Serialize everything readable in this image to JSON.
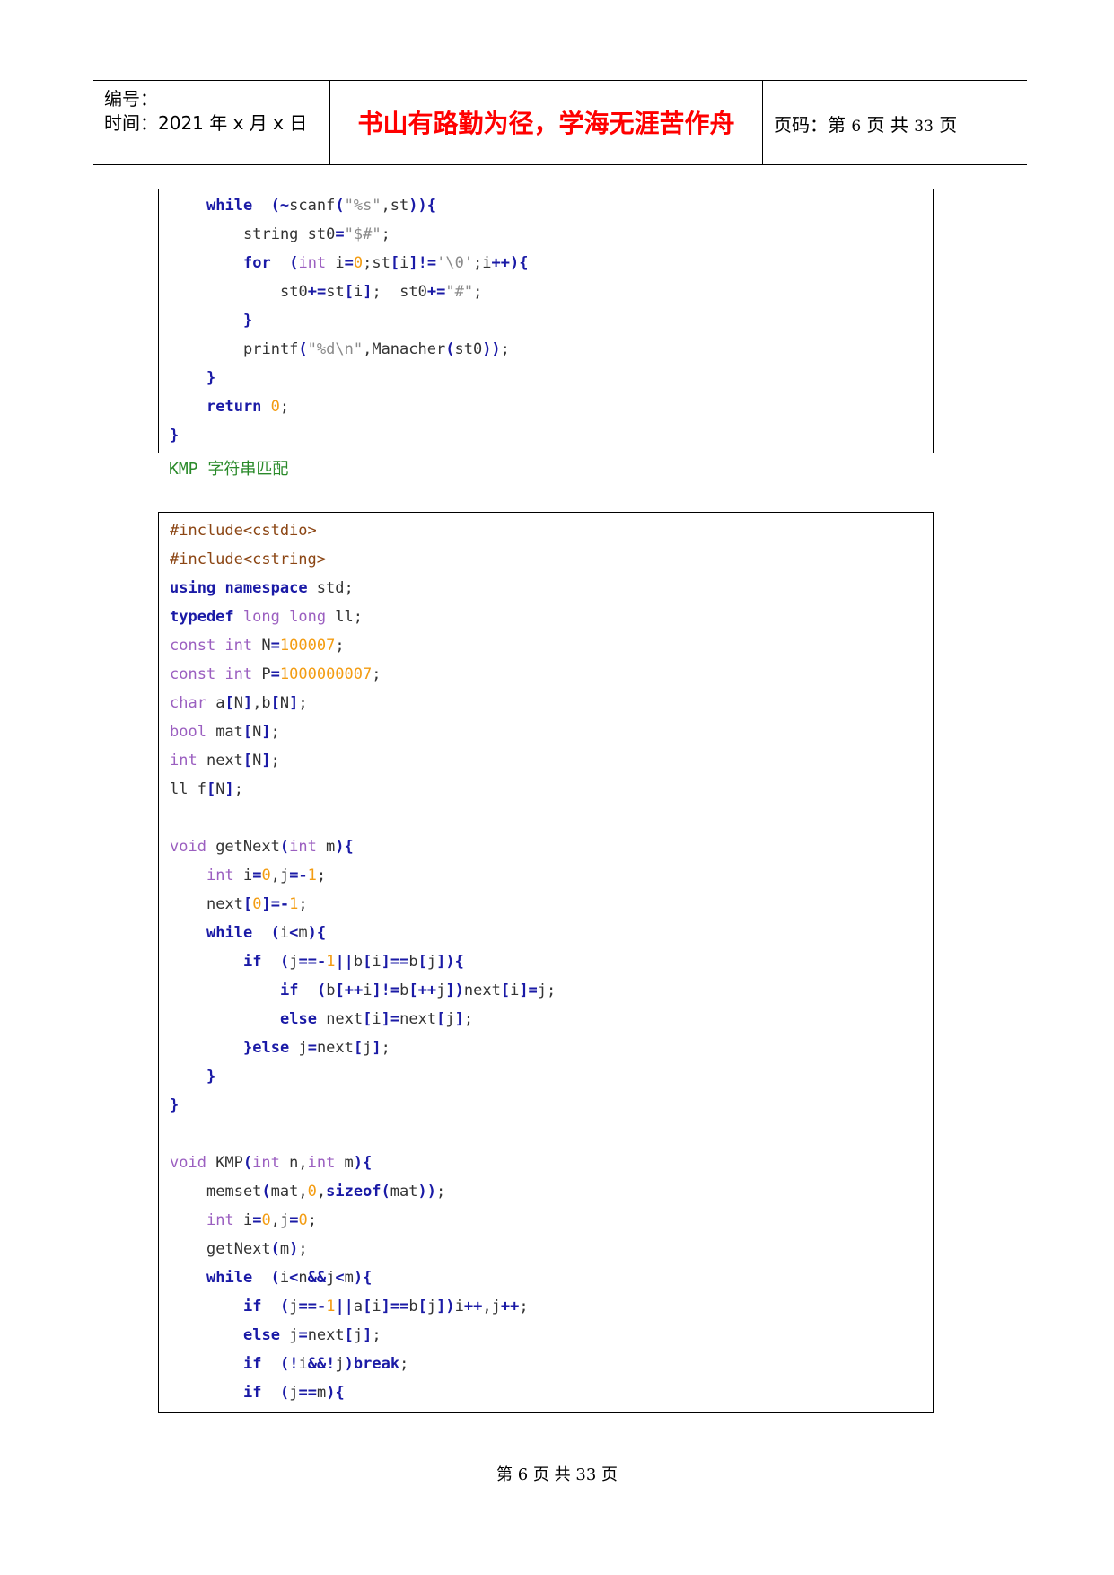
{
  "header": {
    "number_label": "编号：",
    "date_label": "时间：2021 年 x 月 x 日",
    "motto": "书山有路勤为径，学海无涯苦作舟",
    "page_prefix": "页码：第",
    "page_current": "6",
    "page_mid": "页  共",
    "page_total": "33",
    "page_suffix": "页"
  },
  "code_block_1": [
    [
      4,
      [
        [
          "kw",
          "while"
        ],
        [
          "",
          "  "
        ],
        [
          "op",
          "(~"
        ],
        [
          "",
          "scanf"
        ],
        [
          "op",
          "("
        ],
        [
          "st",
          "\"%s\""
        ],
        [
          "",
          ","
        ],
        [
          "",
          "st"
        ],
        [
          "op",
          "))"
        ],
        [
          "op",
          "{"
        ]
      ]
    ],
    [
      8,
      [
        [
          "",
          "string st0"
        ],
        [
          "op",
          "="
        ],
        [
          "st",
          "\"$#\""
        ],
        [
          "",
          ";"
        ]
      ]
    ],
    [
      8,
      [
        [
          "kw",
          "for"
        ],
        [
          "",
          "  "
        ],
        [
          "op",
          "("
        ],
        [
          "ty",
          "int"
        ],
        [
          "",
          " i"
        ],
        [
          "op",
          "="
        ],
        [
          "nm",
          "0"
        ],
        [
          "",
          ";st"
        ],
        [
          "op",
          "["
        ],
        [
          "",
          "i"
        ],
        [
          "op",
          "]!="
        ],
        [
          "st",
          "'\\0'"
        ],
        [
          "",
          ";i"
        ],
        [
          "op",
          "++){"
        ]
      ]
    ],
    [
      12,
      [
        [
          "",
          "st0"
        ],
        [
          "op",
          "+="
        ],
        [
          "",
          "st"
        ],
        [
          "op",
          "["
        ],
        [
          "",
          "i"
        ],
        [
          "op",
          "]"
        ],
        [
          "",
          ";  st0"
        ],
        [
          "op",
          "+="
        ],
        [
          "st",
          "\"#\""
        ],
        [
          "",
          ";"
        ]
      ]
    ],
    [
      8,
      [
        [
          "op",
          "}"
        ]
      ]
    ],
    [
      8,
      [
        [
          "",
          "printf"
        ],
        [
          "op",
          "("
        ],
        [
          "st",
          "\"%d\\n\""
        ],
        [
          "",
          ",Manacher"
        ],
        [
          "op",
          "("
        ],
        [
          "",
          "st0"
        ],
        [
          "op",
          "))"
        ],
        [
          "",
          ";"
        ]
      ]
    ],
    [
      4,
      [
        [
          "op",
          "}"
        ]
      ]
    ],
    [
      4,
      [
        [
          "kw",
          "return"
        ],
        [
          "",
          " "
        ],
        [
          "nm",
          "0"
        ],
        [
          "",
          ";"
        ]
      ]
    ],
    [
      0,
      [
        [
          "op",
          "}"
        ]
      ]
    ]
  ],
  "caption": "KMP 字符串匹配",
  "code_block_2": [
    [
      0,
      [
        [
          "pp",
          "#include<cstdio>"
        ]
      ]
    ],
    [
      0,
      [
        [
          "pp",
          "#include<cstring>"
        ]
      ]
    ],
    [
      0,
      [
        [
          "kw",
          "using"
        ],
        [
          "",
          " "
        ],
        [
          "kw",
          "namespace"
        ],
        [
          "",
          " std;"
        ]
      ]
    ],
    [
      0,
      [
        [
          "kw",
          "typedef"
        ],
        [
          "",
          " "
        ],
        [
          "ty",
          "long"
        ],
        [
          "",
          " "
        ],
        [
          "ty",
          "long"
        ],
        [
          "",
          " ll;"
        ]
      ]
    ],
    [
      0,
      [
        [
          "ty",
          "const"
        ],
        [
          "",
          " "
        ],
        [
          "ty",
          "int"
        ],
        [
          "",
          " N"
        ],
        [
          "op",
          "="
        ],
        [
          "nm",
          "100007"
        ],
        [
          "",
          ";"
        ]
      ]
    ],
    [
      0,
      [
        [
          "ty",
          "const"
        ],
        [
          "",
          " "
        ],
        [
          "ty",
          "int"
        ],
        [
          "",
          " P"
        ],
        [
          "op",
          "="
        ],
        [
          "nm",
          "1000000007"
        ],
        [
          "",
          ";"
        ]
      ]
    ],
    [
      0,
      [
        [
          "ty",
          "char"
        ],
        [
          "",
          " a"
        ],
        [
          "op",
          "["
        ],
        [
          "",
          "N"
        ],
        [
          "op",
          "]"
        ],
        [
          "",
          ",b"
        ],
        [
          "op",
          "["
        ],
        [
          "",
          "N"
        ],
        [
          "op",
          "]"
        ],
        [
          "",
          ";"
        ]
      ]
    ],
    [
      0,
      [
        [
          "ty",
          "bool"
        ],
        [
          "",
          " mat"
        ],
        [
          "op",
          "["
        ],
        [
          "",
          "N"
        ],
        [
          "op",
          "]"
        ],
        [
          "",
          ";"
        ]
      ]
    ],
    [
      0,
      [
        [
          "ty",
          "int"
        ],
        [
          "",
          " next"
        ],
        [
          "op",
          "["
        ],
        [
          "",
          "N"
        ],
        [
          "op",
          "]"
        ],
        [
          "",
          ";"
        ]
      ]
    ],
    [
      0,
      [
        [
          "",
          "ll f"
        ],
        [
          "op",
          "["
        ],
        [
          "",
          "N"
        ],
        [
          "op",
          "]"
        ],
        [
          "",
          ";"
        ]
      ]
    ],
    [
      0,
      []
    ],
    [
      0,
      [
        [
          "ty",
          "void"
        ],
        [
          "",
          " getNext"
        ],
        [
          "op",
          "("
        ],
        [
          "ty",
          "int"
        ],
        [
          "",
          " m"
        ],
        [
          "op",
          "){"
        ]
      ]
    ],
    [
      4,
      [
        [
          "ty",
          "int"
        ],
        [
          "",
          " i"
        ],
        [
          "op",
          "="
        ],
        [
          "nm",
          "0"
        ],
        [
          "",
          ",j"
        ],
        [
          "op",
          "=-"
        ],
        [
          "nm",
          "1"
        ],
        [
          "",
          ";"
        ]
      ]
    ],
    [
      4,
      [
        [
          "",
          "next"
        ],
        [
          "op",
          "["
        ],
        [
          "nm",
          "0"
        ],
        [
          "op",
          "]=-"
        ],
        [
          "nm",
          "1"
        ],
        [
          "",
          ";"
        ]
      ]
    ],
    [
      4,
      [
        [
          "kw",
          "while"
        ],
        [
          "",
          "  "
        ],
        [
          "op",
          "("
        ],
        [
          "",
          "i"
        ],
        [
          "op",
          "<"
        ],
        [
          "",
          "m"
        ],
        [
          "op",
          "){"
        ]
      ]
    ],
    [
      8,
      [
        [
          "kw",
          "if"
        ],
        [
          "",
          "  "
        ],
        [
          "op",
          "("
        ],
        [
          "",
          "j"
        ],
        [
          "op",
          "==-"
        ],
        [
          "nm",
          "1"
        ],
        [
          "op",
          "||"
        ],
        [
          "",
          "b"
        ],
        [
          "op",
          "["
        ],
        [
          "",
          "i"
        ],
        [
          "op",
          "]=="
        ],
        [
          "",
          "b"
        ],
        [
          "op",
          "["
        ],
        [
          "",
          "j"
        ],
        [
          "op",
          "]){"
        ]
      ]
    ],
    [
      12,
      [
        [
          "kw",
          "if"
        ],
        [
          "",
          "  "
        ],
        [
          "op",
          "("
        ],
        [
          "",
          "b"
        ],
        [
          "op",
          "[++"
        ],
        [
          "",
          "i"
        ],
        [
          "op",
          "]!="
        ],
        [
          "",
          "b"
        ],
        [
          "op",
          "[++"
        ],
        [
          "",
          "j"
        ],
        [
          "op",
          "])"
        ],
        [
          "",
          "next"
        ],
        [
          "op",
          "["
        ],
        [
          "",
          "i"
        ],
        [
          "op",
          "]="
        ],
        [
          "",
          "j"
        ],
        [
          "",
          ";"
        ]
      ]
    ],
    [
      12,
      [
        [
          "kw",
          "else"
        ],
        [
          "",
          " next"
        ],
        [
          "op",
          "["
        ],
        [
          "",
          "i"
        ],
        [
          "op",
          "]="
        ],
        [
          "",
          "next"
        ],
        [
          "op",
          "["
        ],
        [
          "",
          "j"
        ],
        [
          "op",
          "]"
        ],
        [
          "",
          ";"
        ]
      ]
    ],
    [
      8,
      [
        [
          "op",
          "}"
        ],
        [
          "kw",
          "else"
        ],
        [
          "",
          " j"
        ],
        [
          "op",
          "="
        ],
        [
          "",
          "next"
        ],
        [
          "op",
          "["
        ],
        [
          "",
          "j"
        ],
        [
          "op",
          "]"
        ],
        [
          "",
          ";"
        ]
      ]
    ],
    [
      4,
      [
        [
          "op",
          "}"
        ]
      ]
    ],
    [
      0,
      [
        [
          "op",
          "}"
        ]
      ]
    ],
    [
      0,
      []
    ],
    [
      0,
      [
        [
          "ty",
          "void"
        ],
        [
          "",
          " KMP"
        ],
        [
          "op",
          "("
        ],
        [
          "ty",
          "int"
        ],
        [
          "",
          " n,"
        ],
        [
          "ty",
          "int"
        ],
        [
          "",
          " m"
        ],
        [
          "op",
          "){"
        ]
      ]
    ],
    [
      4,
      [
        [
          "",
          "memset"
        ],
        [
          "op",
          "("
        ],
        [
          "",
          "mat,"
        ],
        [
          "nm",
          "0"
        ],
        [
          "",
          ","
        ],
        [
          "kw",
          "sizeof"
        ],
        [
          "op",
          "("
        ],
        [
          "",
          "mat"
        ],
        [
          "op",
          "))"
        ],
        [
          "",
          ";"
        ]
      ]
    ],
    [
      4,
      [
        [
          "ty",
          "int"
        ],
        [
          "",
          " i"
        ],
        [
          "op",
          "="
        ],
        [
          "nm",
          "0"
        ],
        [
          "",
          ",j"
        ],
        [
          "op",
          "="
        ],
        [
          "nm",
          "0"
        ],
        [
          "",
          ";"
        ]
      ]
    ],
    [
      4,
      [
        [
          "",
          "getNext"
        ],
        [
          "op",
          "("
        ],
        [
          "",
          "m"
        ],
        [
          "op",
          ")"
        ],
        [
          "",
          ";"
        ]
      ]
    ],
    [
      4,
      [
        [
          "kw",
          "while"
        ],
        [
          "",
          "  "
        ],
        [
          "op",
          "("
        ],
        [
          "",
          "i"
        ],
        [
          "op",
          "<"
        ],
        [
          "",
          "n"
        ],
        [
          "op",
          "&&"
        ],
        [
          "",
          "j"
        ],
        [
          "op",
          "<"
        ],
        [
          "",
          "m"
        ],
        [
          "op",
          "){"
        ]
      ]
    ],
    [
      8,
      [
        [
          "kw",
          "if"
        ],
        [
          "",
          "  "
        ],
        [
          "op",
          "("
        ],
        [
          "",
          "j"
        ],
        [
          "op",
          "==-"
        ],
        [
          "nm",
          "1"
        ],
        [
          "op",
          "||"
        ],
        [
          "",
          "a"
        ],
        [
          "op",
          "["
        ],
        [
          "",
          "i"
        ],
        [
          "op",
          "]=="
        ],
        [
          "",
          "b"
        ],
        [
          "op",
          "["
        ],
        [
          "",
          "j"
        ],
        [
          "op",
          "])"
        ],
        [
          "",
          "i"
        ],
        [
          "op",
          "++"
        ],
        [
          "",
          ",j"
        ],
        [
          "op",
          "++"
        ],
        [
          "",
          ";"
        ]
      ]
    ],
    [
      8,
      [
        [
          "kw",
          "else"
        ],
        [
          "",
          " j"
        ],
        [
          "op",
          "="
        ],
        [
          "",
          "next"
        ],
        [
          "op",
          "["
        ],
        [
          "",
          "j"
        ],
        [
          "op",
          "]"
        ],
        [
          "",
          ";"
        ]
      ]
    ],
    [
      8,
      [
        [
          "kw",
          "if"
        ],
        [
          "",
          "  "
        ],
        [
          "op",
          "(!"
        ],
        [
          "",
          "i"
        ],
        [
          "op",
          "&&!"
        ],
        [
          "",
          "j"
        ],
        [
          "op",
          ")"
        ],
        [
          "kw",
          "break"
        ],
        [
          "",
          ";"
        ]
      ]
    ],
    [
      8,
      [
        [
          "kw",
          "if"
        ],
        [
          "",
          "  "
        ],
        [
          "op",
          "("
        ],
        [
          "",
          "j"
        ],
        [
          "op",
          "=="
        ],
        [
          "",
          "m"
        ],
        [
          "op",
          "){"
        ]
      ]
    ]
  ],
  "footer": {
    "prefix": "第",
    "current": "6",
    "mid": "页  共",
    "total": "33",
    "suffix": "页"
  }
}
